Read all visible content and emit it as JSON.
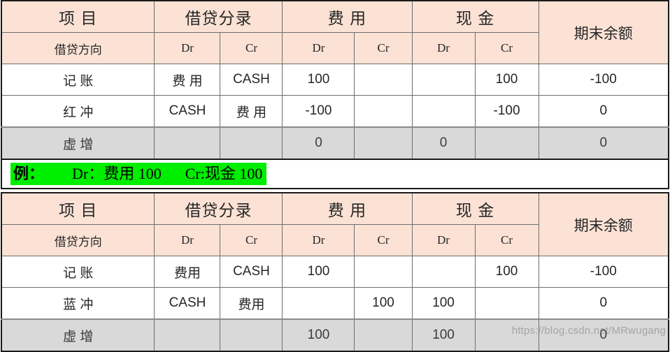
{
  "tables": [
    {
      "id": "red-reversal-table",
      "header_top": [
        {
          "label": "项    目",
          "span": 1
        },
        {
          "label": "借贷分录",
          "span": 2
        },
        {
          "label": "费    用",
          "span": 2
        },
        {
          "label": "现    金",
          "span": 2
        },
        {
          "label": "期末余额",
          "span": 1
        }
      ],
      "header_sub": [
        "借贷方向",
        "Dr",
        "Cr",
        "Dr",
        "Cr",
        "Dr",
        "Cr"
      ],
      "balance_header": "期末余额",
      "rows": [
        {
          "style": "normal",
          "color": "#262626",
          "cells": [
            "记    账",
            "费 用",
            "CASH",
            "100",
            "",
            "",
            "100",
            "-100"
          ]
        },
        {
          "style": "red",
          "color": "#FF0000",
          "cells": [
            "红    冲",
            "CASH",
            "费 用",
            "-100",
            "",
            "",
            "-100",
            "0"
          ]
        },
        {
          "style": "gray",
          "color": "#3b3b3b",
          "cells": [
            "虚    增",
            "",
            "",
            "0",
            "",
            "0",
            "",
            "0"
          ]
        }
      ]
    },
    {
      "id": "blue-reversal-table",
      "header_top": [
        {
          "label": "项    目",
          "span": 1
        },
        {
          "label": "借贷分录",
          "span": 2
        },
        {
          "label": "费    用",
          "span": 2
        },
        {
          "label": "现    金",
          "span": 2
        },
        {
          "label": "期末余额",
          "span": 1
        }
      ],
      "header_sub": [
        "借贷方向",
        "Dr",
        "Cr",
        "Dr",
        "Cr",
        "Dr",
        "Cr"
      ],
      "balance_header": "期末余额",
      "rows": [
        {
          "style": "normal",
          "color": "#262626",
          "cells": [
            "记    账",
            "费用",
            "CASH",
            "100",
            "",
            "",
            "100",
            "-100"
          ]
        },
        {
          "style": "blue",
          "color": "#1F7BC4",
          "cells": [
            "蓝    冲",
            "CASH",
            "费用",
            "",
            "100",
            "100",
            "",
            "0"
          ]
        },
        {
          "style": "gray",
          "color": "#3b3b3b",
          "cells": [
            "虚    增",
            "",
            "",
            "100",
            "",
            "100",
            "",
            "0"
          ]
        }
      ]
    }
  ],
  "example": {
    "label": "例：",
    "debit": "Dr：费用 100",
    "credit": "Cr:现金 100",
    "highlight_color": "#00EE00"
  },
  "watermark": "https://blog.csdn.net/MRwugang",
  "colors": {
    "header_bg": "#FBE2D5",
    "gray_bg": "#D9D9D9",
    "red": "#FF0000",
    "blue": "#1F7BC4",
    "green": "#00EE00",
    "border": "#6e6e6e",
    "outer_border": "#1a1a1a"
  }
}
